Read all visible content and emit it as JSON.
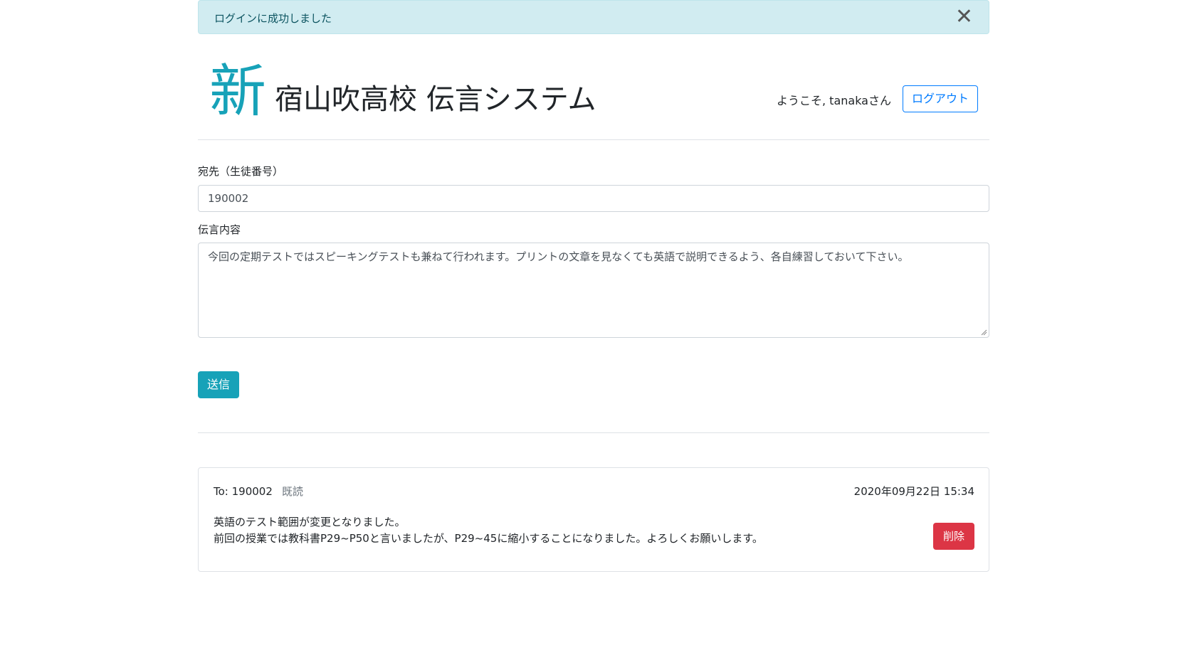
{
  "alert": {
    "message": "ログインに成功しました",
    "close_symbol": "✕"
  },
  "header": {
    "logo_mark": "新",
    "title": "宿山吹高校 伝言システム",
    "welcome": "ようこそ, tanakaさん",
    "logout_label": "ログアウト"
  },
  "form": {
    "recipient_label": "宛先（生徒番号）",
    "recipient_value": "190002",
    "content_label": "伝言内容",
    "content_value": "今回の定期テストではスピーキングテストも兼ねて行われます。プリントの文章を見なくても英語で説明できるよう、各自練習しておいて下さい。",
    "submit_label": "送信"
  },
  "messages": [
    {
      "to": "To: 190002",
      "status": "既読",
      "date": "2020年09月22日 15:34",
      "lines": [
        "英語のテスト範囲が変更となりました。",
        "前回の授業では教科書P29~P50と言いましたが、P29~45に縮小することになりました。よろしくお願いします。"
      ],
      "delete_label": "削除"
    }
  ],
  "colors": {
    "accent": "#17a2b8",
    "primary": "#007bff",
    "danger": "#dc3545",
    "alert_bg": "#d1ecf1"
  }
}
